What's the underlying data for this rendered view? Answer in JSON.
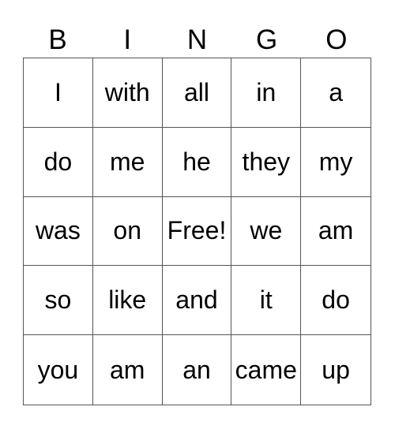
{
  "header": [
    "B",
    "I",
    "N",
    "G",
    "O"
  ],
  "cells": [
    [
      "I",
      "with",
      "all",
      "in",
      "a"
    ],
    [
      "do",
      "me",
      "he",
      "they",
      "my"
    ],
    [
      "was",
      "on",
      "Free!",
      "we",
      "am"
    ],
    [
      "so",
      "like",
      "and",
      "it",
      "do"
    ],
    [
      "you",
      "am",
      "an",
      "came",
      "up"
    ]
  ]
}
